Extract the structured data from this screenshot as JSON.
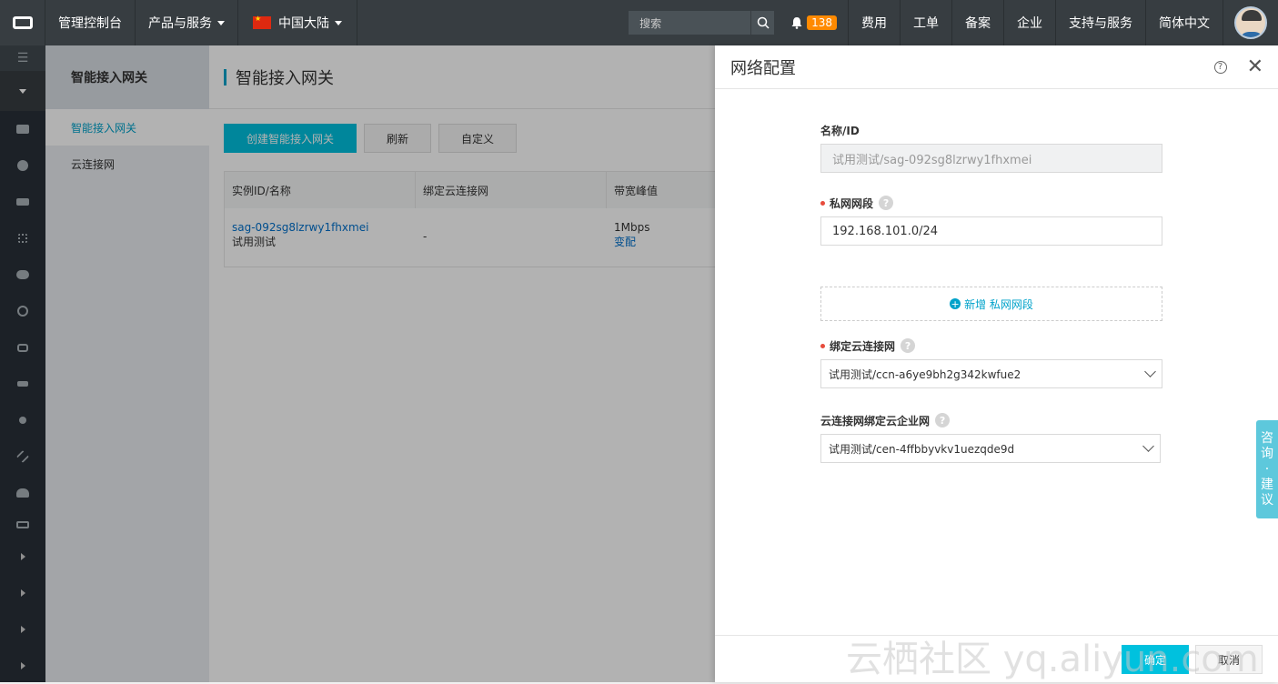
{
  "topbar": {
    "console": "管理控制台",
    "products": "产品与服务",
    "region": "中国大陆",
    "search_placeholder": "搜索",
    "notification_count": "138",
    "links": [
      "费用",
      "工单",
      "备案",
      "企业",
      "支持与服务",
      "简体中文"
    ]
  },
  "subnav": {
    "title": "智能接入网关",
    "items": [
      "智能接入网关",
      "云连接网"
    ]
  },
  "main": {
    "title": "智能接入网关",
    "buttons": {
      "create": "创建智能接入网关",
      "refresh": "刷新",
      "customize": "自定义"
    },
    "columns": [
      "实例ID/名称",
      "绑定云连接网",
      "带宽峰值"
    ],
    "row": {
      "id": "sag-092sg8lzrwy1fhxmei",
      "name": "试用测试",
      "ccn": "-",
      "bandwidth": "1Mbps",
      "action": "变配"
    }
  },
  "drawer": {
    "title": "网络配置",
    "name_label": "名称/ID",
    "name_value": "试用测试/sag-092sg8lzrwy1fhxmei",
    "cidr_label": "私网网段",
    "cidr_value": "192.168.101.0/24",
    "add_cidr": "新增 私网网段",
    "ccn_label": "绑定云连接网",
    "ccn_value": "试用测试/ccn-a6ye9bh2g342kwfue2",
    "cen_label": "云连接网绑定云企业网",
    "cen_value": "试用测试/cen-4ffbbyvkv1uezqde9d",
    "ok": "确定",
    "cancel": "取消"
  },
  "consult": [
    "咨",
    "询",
    "·",
    "建",
    "议"
  ],
  "watermark": "云栖社区 yq.aliyun.com"
}
